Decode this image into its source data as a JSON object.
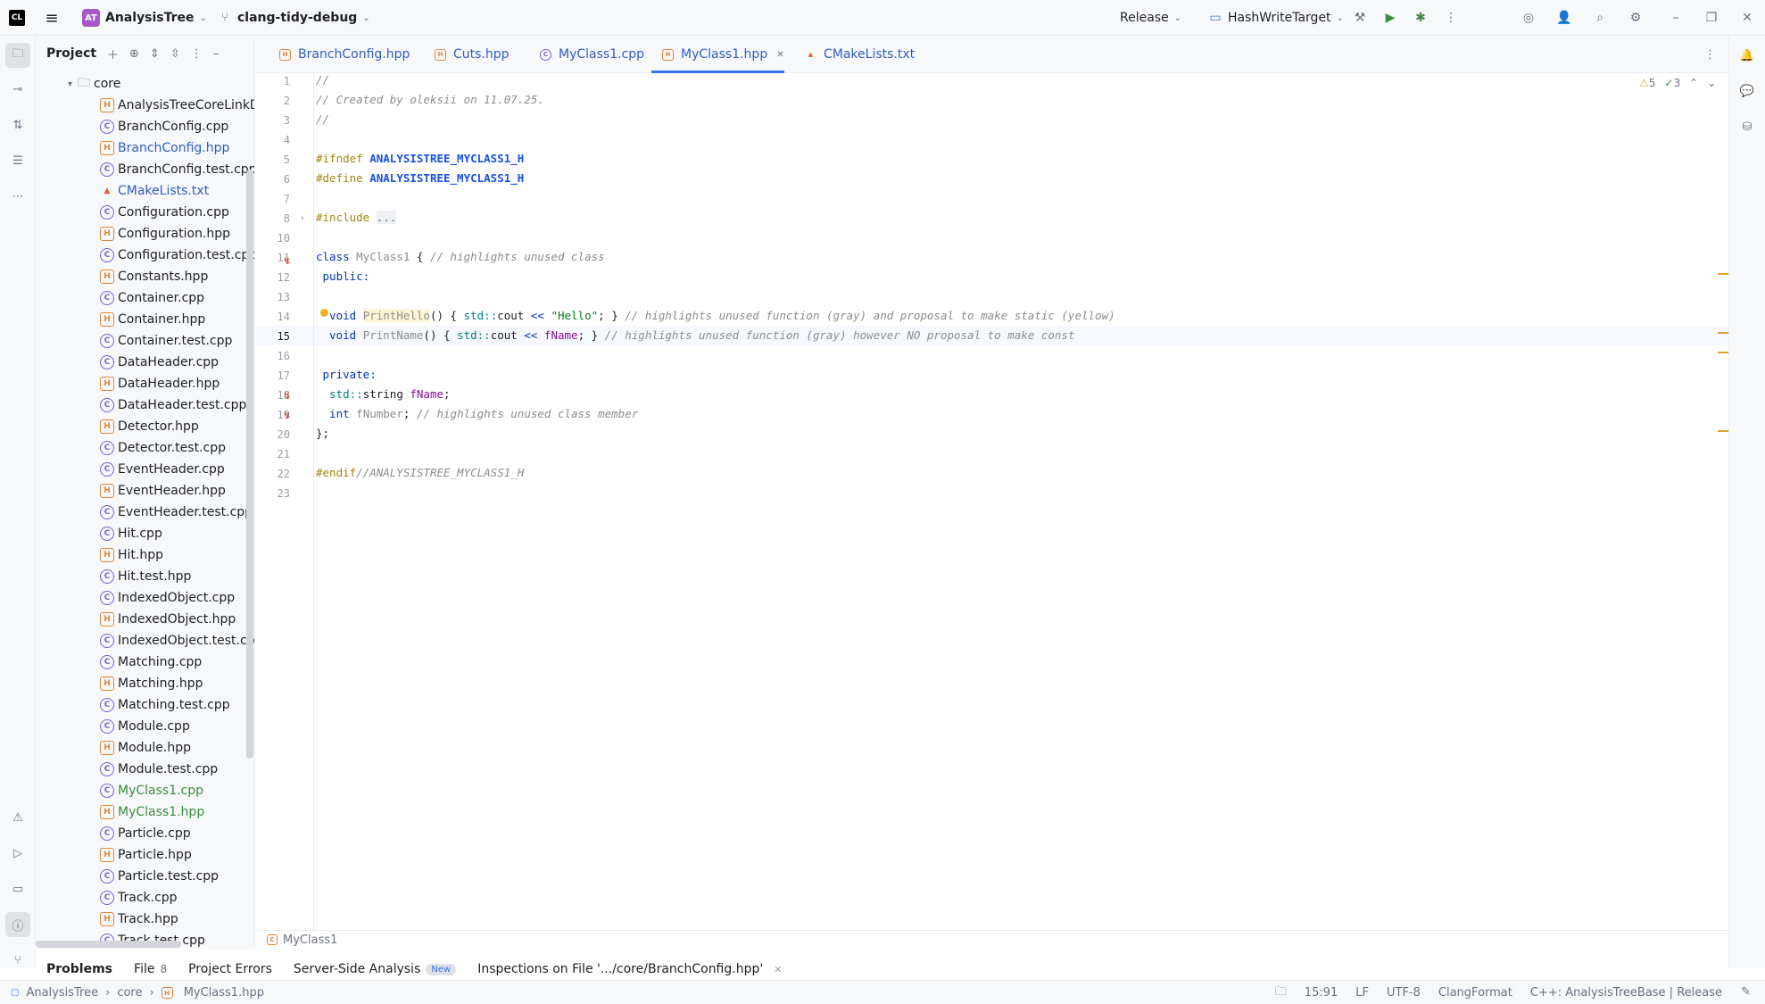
{
  "titlebar": {
    "project_initials": "AT",
    "project_name": "AnalysisTree",
    "branch": "clang-tidy-debug",
    "build_config": "Release",
    "run_target": "HashWriteTarget"
  },
  "project_panel": {
    "title": "Project",
    "folder": "core",
    "files": [
      {
        "name": "AnalysisTreeCoreLinkDef.h",
        "type": "h",
        "color": "normal"
      },
      {
        "name": "BranchConfig.cpp",
        "type": "c",
        "color": "normal"
      },
      {
        "name": "BranchConfig.hpp",
        "type": "h",
        "color": "blue"
      },
      {
        "name": "BranchConfig.test.cpp",
        "type": "c",
        "color": "normal"
      },
      {
        "name": "CMakeLists.txt",
        "type": "cmake",
        "color": "blue"
      },
      {
        "name": "Configuration.cpp",
        "type": "c",
        "color": "normal"
      },
      {
        "name": "Configuration.hpp",
        "type": "h",
        "color": "normal"
      },
      {
        "name": "Configuration.test.cpp",
        "type": "c",
        "color": "normal"
      },
      {
        "name": "Constants.hpp",
        "type": "h",
        "color": "normal"
      },
      {
        "name": "Container.cpp",
        "type": "c",
        "color": "normal"
      },
      {
        "name": "Container.hpp",
        "type": "h",
        "color": "normal"
      },
      {
        "name": "Container.test.cpp",
        "type": "c",
        "color": "normal"
      },
      {
        "name": "DataHeader.cpp",
        "type": "c",
        "color": "normal"
      },
      {
        "name": "DataHeader.hpp",
        "type": "h",
        "color": "normal"
      },
      {
        "name": "DataHeader.test.cpp",
        "type": "c",
        "color": "normal"
      },
      {
        "name": "Detector.hpp",
        "type": "h",
        "color": "normal"
      },
      {
        "name": "Detector.test.cpp",
        "type": "c",
        "color": "normal"
      },
      {
        "name": "EventHeader.cpp",
        "type": "c",
        "color": "normal"
      },
      {
        "name": "EventHeader.hpp",
        "type": "h",
        "color": "normal"
      },
      {
        "name": "EventHeader.test.cpp",
        "type": "c",
        "color": "normal"
      },
      {
        "name": "Hit.cpp",
        "type": "c",
        "color": "normal"
      },
      {
        "name": "Hit.hpp",
        "type": "h",
        "color": "normal"
      },
      {
        "name": "Hit.test.hpp",
        "type": "c",
        "color": "normal"
      },
      {
        "name": "IndexedObject.cpp",
        "type": "c",
        "color": "normal"
      },
      {
        "name": "IndexedObject.hpp",
        "type": "h",
        "color": "normal"
      },
      {
        "name": "IndexedObject.test.cpp",
        "type": "c",
        "color": "normal"
      },
      {
        "name": "Matching.cpp",
        "type": "c",
        "color": "normal"
      },
      {
        "name": "Matching.hpp",
        "type": "h",
        "color": "normal"
      },
      {
        "name": "Matching.test.cpp",
        "type": "c",
        "color": "normal"
      },
      {
        "name": "Module.cpp",
        "type": "c",
        "color": "normal"
      },
      {
        "name": "Module.hpp",
        "type": "h",
        "color": "normal"
      },
      {
        "name": "Module.test.cpp",
        "type": "c",
        "color": "normal"
      },
      {
        "name": "MyClass1.cpp",
        "type": "c",
        "color": "green"
      },
      {
        "name": "MyClass1.hpp",
        "type": "h",
        "color": "green"
      },
      {
        "name": "Particle.cpp",
        "type": "c",
        "color": "normal"
      },
      {
        "name": "Particle.hpp",
        "type": "h",
        "color": "normal"
      },
      {
        "name": "Particle.test.cpp",
        "type": "c",
        "color": "normal"
      },
      {
        "name": "Track.cpp",
        "type": "c",
        "color": "normal"
      },
      {
        "name": "Track.hpp",
        "type": "h",
        "color": "normal"
      },
      {
        "name": "Track.test.cpp",
        "type": "c",
        "color": "normal"
      }
    ]
  },
  "tabs": [
    {
      "label": "BranchConfig.hpp",
      "type": "h"
    },
    {
      "label": "Cuts.hpp",
      "type": "h"
    },
    {
      "label": "MyClass1.cpp",
      "type": "c"
    },
    {
      "label": "MyClass1.hpp",
      "type": "h",
      "active": true
    },
    {
      "label": "CMakeLists.txt",
      "type": "cmake"
    }
  ],
  "editor": {
    "line_numbers": [
      "1",
      "2",
      "3",
      "4",
      "5",
      "6",
      "7",
      "8",
      "10",
      "11",
      "12",
      "13",
      "14",
      "15",
      "16",
      "17",
      "18",
      "19",
      "20",
      "21",
      "22",
      "23"
    ],
    "current_line": "15",
    "warnings_count": "5",
    "weak_warnings_count": "3",
    "code": {
      "l1": "//",
      "l2": "// Created by oleksii on 11.07.25.",
      "l3": "//",
      "l5_directive": "#ifndef",
      "l5_macro": "ANALYSISTREE_MYCLASS1_H",
      "l6_directive": "#define",
      "l6_macro": "ANALYSISTREE_MYCLASS1_H",
      "l8_directive": "#include",
      "l8_folded": "...",
      "l11_kw": "class",
      "l11_name": "MyClass1",
      "l11_brace": " {",
      "l11_comment": " // highlights unused class",
      "l12": " public:",
      "l14_kw": "  void",
      "l14_fn": "PrintHello",
      "l14_mid": "() { ",
      "l14_ns": "std::",
      "l14_cout": "cout",
      "l14_op": " << ",
      "l14_str": "\"Hello\"",
      "l14_end": "; }",
      "l14_comment": " // highlights unused function (gray) and proposal to make static (yellow)",
      "l15_kw": "  void",
      "l15_fn": "PrintName",
      "l15_mid": "() { ",
      "l15_ns": "std::",
      "l15_cout": "cout",
      "l15_op": " << ",
      "l15_member": "fName",
      "l15_end": "; }",
      "l15_comment": " // highlights unused function (gray) however NO proposal to make const",
      "l17": " private:",
      "l18_ns": "  std::",
      "l18_type": "string",
      "l18_member": "fName",
      "l18_end": ";",
      "l19_kw": "  int",
      "l19_member": "fNumber",
      "l19_end": ";",
      "l19_comment": " // highlights unused class member",
      "l20": "};",
      "l22_directive": "#endif",
      "l22_comment": "//ANALYSISTREE_MYCLASS1_H"
    },
    "breadcrumb": "MyClass1"
  },
  "bottom_tabs": {
    "problems": "Problems",
    "file": "File",
    "file_count": "8",
    "project_errors": "Project Errors",
    "server_side": "Server-Side Analysis",
    "server_side_badge": "New",
    "inspections": "Inspections on File '.../core/BranchConfig.hpp'"
  },
  "statusbar": {
    "path": [
      "AnalysisTree",
      "core",
      "MyClass1.hpp"
    ],
    "position": "15:91",
    "line_ending": "LF",
    "encoding": "UTF-8",
    "formatter": "ClangFormat",
    "context": "C++: AnalysisTreeBase | Release"
  },
  "colors": {
    "accent": "#3574f0",
    "modified_blue": "#2f5cc4",
    "new_green": "#3d8c40",
    "header_icon": "#e0853a",
    "source_icon": "#7a5ad1"
  }
}
